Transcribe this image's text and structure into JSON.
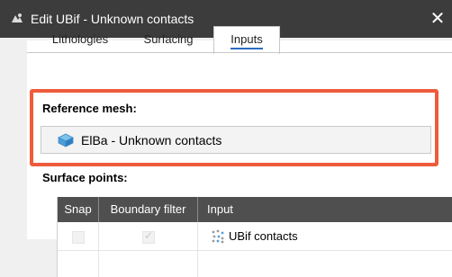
{
  "window": {
    "title": "Edit UBif - Unknown contacts",
    "close_glyph": "✕"
  },
  "tabs": [
    {
      "label": "Lithologies",
      "active": false
    },
    {
      "label": "Surfacing",
      "active": false
    },
    {
      "label": "Inputs",
      "active": true
    }
  ],
  "reference_mesh": {
    "label": "Reference mesh:",
    "value": "ElBa - Unknown contacts",
    "icon": "mesh-icon"
  },
  "surface_points": {
    "label": "Surface points:",
    "columns": [
      "Snap",
      "Boundary filter",
      "Input"
    ],
    "rows": [
      {
        "snap": false,
        "boundary_filter": true,
        "input": "UBif contacts",
        "icon": "points-icon"
      }
    ]
  },
  "colors": {
    "titlebar": "#3c3c3c",
    "highlight": "#ee5b3c",
    "table_header": "#4f4f4f",
    "tab_accent": "#2b6cc4"
  }
}
